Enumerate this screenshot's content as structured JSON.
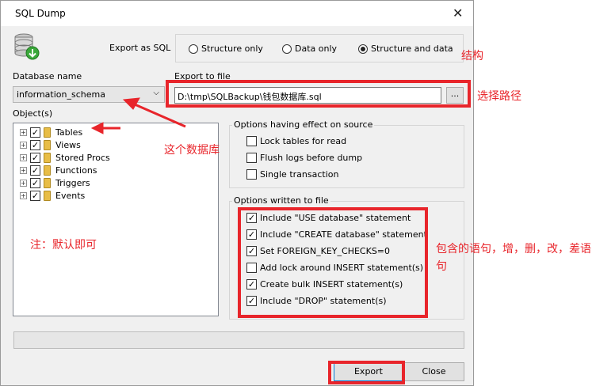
{
  "window": {
    "title": "SQL Dump",
    "close_glyph": "✕"
  },
  "export_as": {
    "label": "Export as SQL",
    "options": [
      "Structure only",
      "Data only",
      "Structure and data"
    ],
    "selected_index": 2
  },
  "database": {
    "label": "Database name",
    "value": "information_schema",
    "chevron": "⌵"
  },
  "export_file": {
    "label": "Export to file",
    "path": "D:\\tmp\\SQLBackup\\钱包数据库.sql",
    "browse": "..."
  },
  "objects": {
    "label": "Object(s)",
    "items": [
      {
        "name": "Tables",
        "checked": true
      },
      {
        "name": "Views",
        "checked": true
      },
      {
        "name": "Stored Procs",
        "checked": true
      },
      {
        "name": "Functions",
        "checked": true
      },
      {
        "name": "Triggers",
        "checked": true
      },
      {
        "name": "Events",
        "checked": true
      }
    ]
  },
  "source_options": {
    "title": "Options having effect on source",
    "items": [
      {
        "label": "Lock tables for read",
        "checked": false
      },
      {
        "label": "Flush logs before dump",
        "checked": false
      },
      {
        "label": "Single transaction",
        "checked": false
      }
    ]
  },
  "file_options": {
    "title": "Options written to file",
    "items": [
      {
        "label": "Include \"USE database\" statement",
        "checked": true
      },
      {
        "label": "Include \"CREATE database\" statement",
        "checked": true
      },
      {
        "label": "Set FOREIGN_KEY_CHECKS=0",
        "checked": true
      },
      {
        "label": "Add lock around INSERT statement(s)",
        "checked": false
      },
      {
        "label": "Create bulk INSERT statement(s)",
        "checked": true
      },
      {
        "label": "Include \"DROP\" statement(s)",
        "checked": true
      }
    ]
  },
  "buttons": {
    "export": "Export",
    "close": "Close"
  },
  "annotations": {
    "structure": "结构",
    "choose_path": "选择路径",
    "this_database": "这个数据库",
    "default_ok": "注：默认即可",
    "statements_1": "包含的语句，增，删，改，差语",
    "statements_2": "句",
    "color": "#e8252b"
  },
  "icons": {
    "check": "✓",
    "db": "database-export-icon",
    "folder": "folder-icon"
  }
}
